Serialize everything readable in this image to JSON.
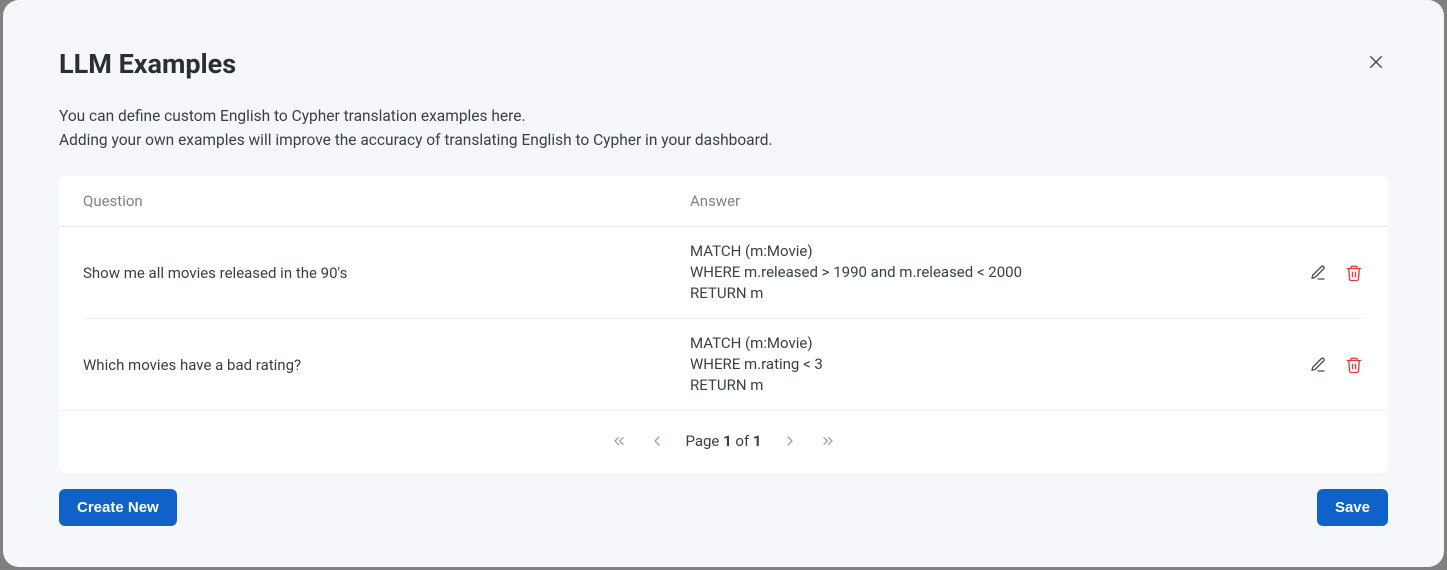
{
  "modal": {
    "title": "LLM Examples",
    "description_line1": "You can define custom English to Cypher translation examples here.",
    "description_line2": "Adding your own examples will improve the accuracy of translating English to Cypher in your dashboard."
  },
  "table": {
    "headers": {
      "question": "Question",
      "answer": "Answer"
    },
    "rows": [
      {
        "question": "Show me all movies released in the 90's",
        "answer": "MATCH (m:Movie)\nWHERE m.released > 1990 and m.released < 2000\nRETURN m"
      },
      {
        "question": "Which movies have a bad rating?",
        "answer": "MATCH (m:Movie)\nWHERE m.rating < 3\nRETURN m"
      }
    ]
  },
  "pagination": {
    "prefix": "Page ",
    "current": "1",
    "of": " of ",
    "total": "1"
  },
  "footer": {
    "create_label": "Create New",
    "save_label": "Save"
  }
}
